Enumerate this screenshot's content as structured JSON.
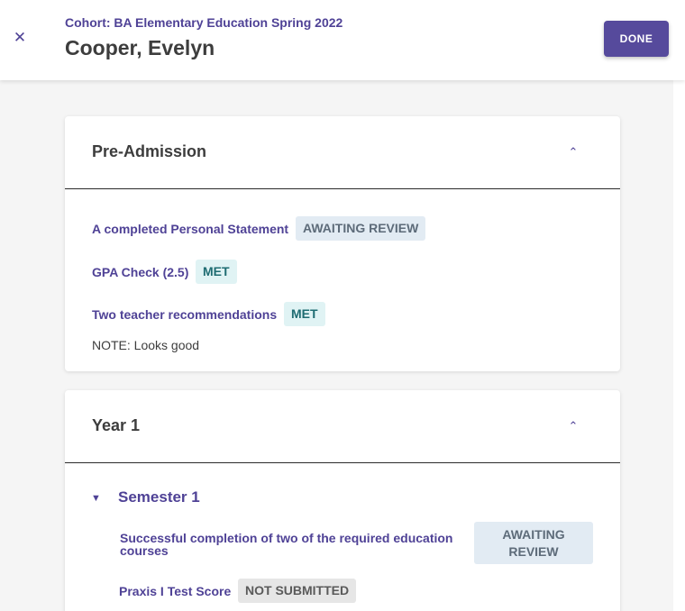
{
  "header": {
    "close_icon": "close-icon",
    "cohort": "Cohort: BA Elementary Education Spring 2022",
    "student_name": "Cooper, Evelyn",
    "done_label": "DONE"
  },
  "colors": {
    "brand": "#564a9c",
    "link": "#4f4296",
    "review_bg": "#e2ebf3",
    "met_bg": "#e0f3f4",
    "not_submitted_bg": "#e6e6e6"
  },
  "pre_admission": {
    "title": "Pre-Admission",
    "collapse_icon": "chevron-up-icon",
    "requirements": [
      {
        "label": "A completed Personal Statement",
        "status": "AWAITING REVIEW"
      },
      {
        "label": "GPA Check (2.5)",
        "status": "MET"
      },
      {
        "label": "Two teacher recommendations",
        "status": "MET"
      }
    ],
    "note": "NOTE: Looks good"
  },
  "year1": {
    "title": "Year 1",
    "collapse_icon": "chevron-up-icon",
    "semester": {
      "title": "Semester 1",
      "caret_icon": "caret-down-icon",
      "requirements": [
        {
          "label": "Successful completion of two of the required education courses",
          "status": "AWAITING REVIEW"
        },
        {
          "label": "Praxis I Test Score",
          "status": "NOT SUBMITTED"
        }
      ]
    }
  }
}
